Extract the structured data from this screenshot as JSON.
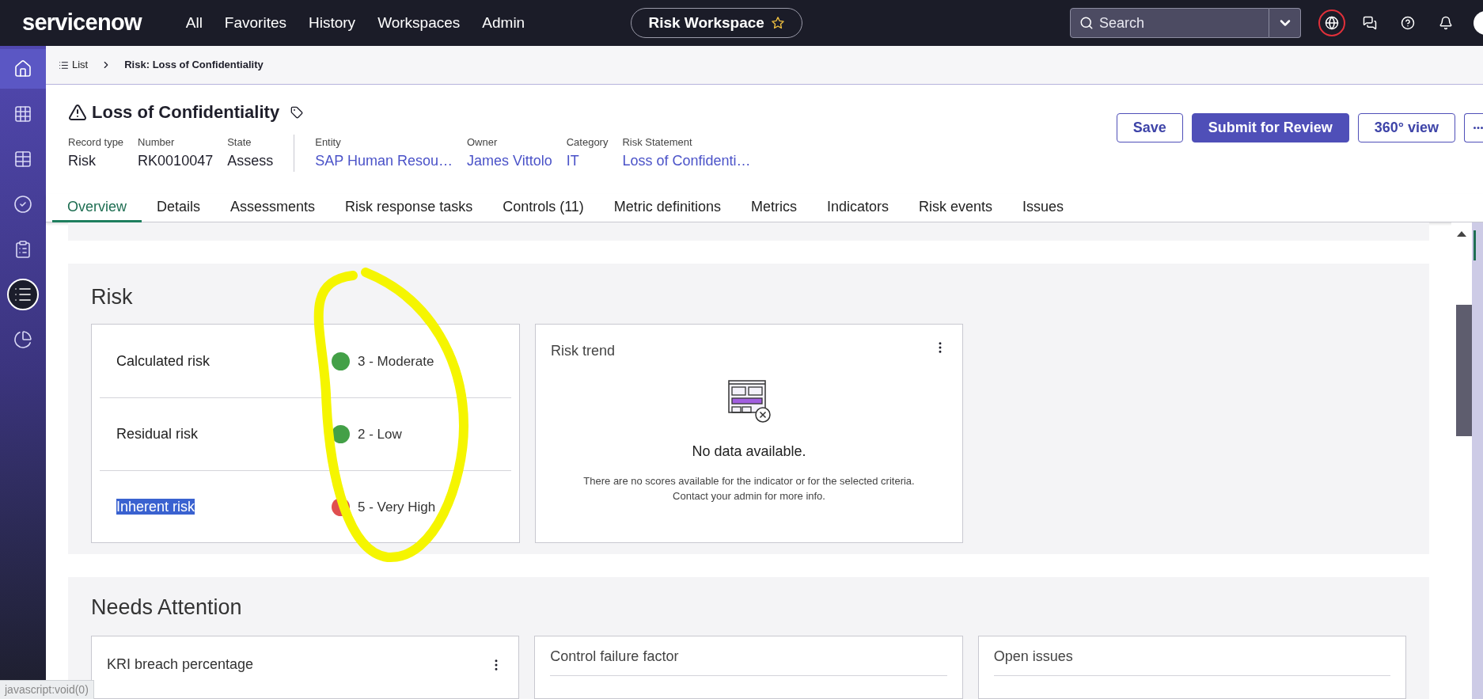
{
  "top_nav": {
    "logo": "servicenow",
    "menu": [
      "All",
      "Favorites",
      "History",
      "Workspaces",
      "Admin"
    ],
    "workspace": "Risk Workspace",
    "search": {
      "placeholder": "Search"
    }
  },
  "sidebar": {
    "items": [
      {
        "kind": "home",
        "selected": true
      },
      {
        "kind": "apps",
        "selected": false
      },
      {
        "kind": "table",
        "selected": false
      },
      {
        "kind": "approvals",
        "selected": false
      },
      {
        "kind": "clipboard",
        "selected": false
      },
      {
        "kind": "list",
        "selected": true
      },
      {
        "kind": "analytics",
        "selected": false
      }
    ]
  },
  "breadcrumb": {
    "list_link": "List",
    "current": "Risk: Loss of Confidentiality"
  },
  "record": {
    "title": "Loss of Confidentiality",
    "field_groups": [
      [
        {
          "label": "Record type",
          "value": "Risk",
          "kind": "text"
        },
        {
          "label": "Number",
          "value": "RK0010047",
          "kind": "text"
        },
        {
          "label": "State",
          "value": "Assess",
          "kind": "text"
        }
      ],
      [
        {
          "label": "Entity",
          "value": "SAP Human Resou…",
          "kind": "link"
        },
        {
          "label": "Owner",
          "value": "James Vittolo",
          "kind": "link"
        },
        {
          "label": "Category",
          "value": "IT",
          "kind": "link"
        },
        {
          "label": "Risk Statement",
          "value": "Loss of Confidenti…",
          "kind": "link"
        }
      ]
    ]
  },
  "actions": [
    {
      "label": "Save",
      "primary": false
    },
    {
      "label": "Submit for Review",
      "primary": true
    },
    {
      "label": "360° view",
      "primary": false
    }
  ],
  "tabs": [
    {
      "label": "Overview",
      "selected": true
    },
    {
      "label": "Details",
      "selected": false
    },
    {
      "label": "Assessments",
      "selected": false
    },
    {
      "label": "Risk response tasks",
      "selected": false
    },
    {
      "label": "Controls (11)",
      "selected": false
    },
    {
      "label": "Metric definitions",
      "selected": false
    },
    {
      "label": "Metrics",
      "selected": false
    },
    {
      "label": "Indicators",
      "selected": false
    },
    {
      "label": "Risk events",
      "selected": false
    },
    {
      "label": "Issues",
      "selected": false
    }
  ],
  "risk_section": {
    "title": "Risk",
    "rows": [
      {
        "label": "Calculated risk",
        "value": "3 - Moderate",
        "color": "#43a047",
        "highlighted": false
      },
      {
        "label": "Residual risk",
        "value": "2 - Low",
        "color": "#43a047",
        "highlighted": false
      },
      {
        "label": "Inherent risk",
        "value": "5 - Very High",
        "color": "#e04f4f",
        "highlighted": true
      }
    ],
    "trend": {
      "title": "Risk trend",
      "empty_title": "No data available.",
      "empty_text": [
        "There are no scores available for the indicator or for the selected criteria.",
        "Contact your admin for more info."
      ]
    }
  },
  "needs_attention": {
    "title": "Needs Attention",
    "cards": [
      {
        "title": "KRI breach percentage",
        "has_menu": true
      },
      {
        "title": "Control failure factor",
        "has_menu": false
      },
      {
        "title": "Open issues",
        "has_menu": false
      }
    ]
  },
  "status_bar": "javascript:void(0)"
}
